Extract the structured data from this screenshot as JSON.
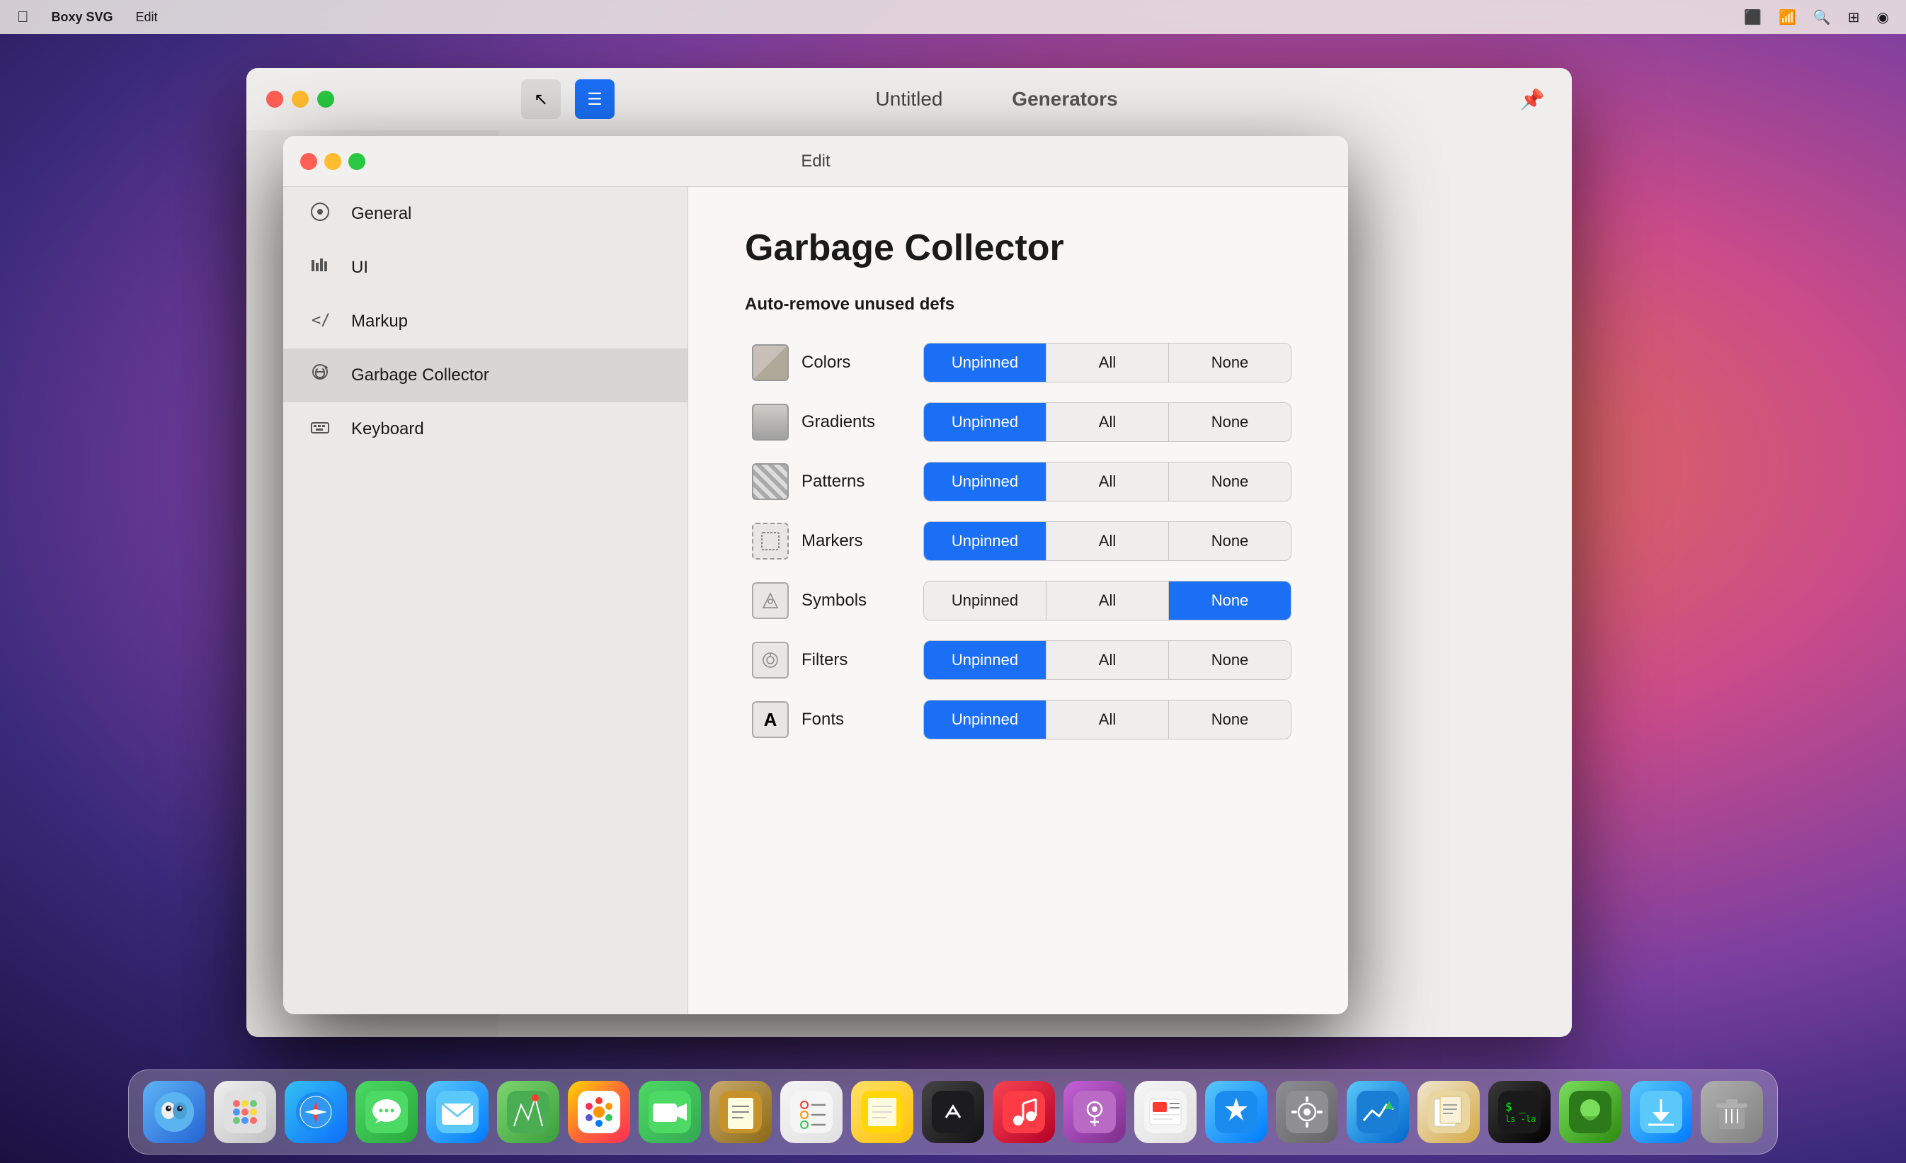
{
  "desktop": {
    "bg_colors": [
      "#e8724a",
      "#c94b8a",
      "#7b3fa0",
      "#3a2a7a",
      "#1a1040"
    ]
  },
  "menubar": {
    "apple": "🍎",
    "app_name": "Boxy SVG",
    "menu_items": [
      "Edit"
    ],
    "right_icons": [
      "monitor-icon",
      "wifi-icon",
      "search-icon",
      "controlcenter-icon",
      "siri-icon"
    ]
  },
  "window_back": {
    "title": "Untitled",
    "controls": {
      "close": "#ff5f57",
      "minimize": "#febc2e",
      "maximize": "#28c840"
    },
    "generators": {
      "title": "Generators",
      "pin_icon": "📌"
    }
  },
  "window_front": {
    "title": "Edit",
    "controls": {
      "close": "#ff5f57",
      "minimize": "#febc2e",
      "maximize": "#28c840"
    },
    "sidebar": {
      "items": [
        {
          "id": "general",
          "icon": "⚙️",
          "label": "General"
        },
        {
          "id": "ui",
          "icon": "📊",
          "label": "UI"
        },
        {
          "id": "markup",
          "icon": "⟨⟩",
          "label": "Markup"
        },
        {
          "id": "garbage-collector",
          "icon": "♻️",
          "label": "Garbage Collector",
          "active": true
        },
        {
          "id": "keyboard",
          "icon": "⌨️",
          "label": "Keyboard"
        }
      ]
    },
    "content": {
      "title": "Garbage Collector",
      "subtitle": "Auto-remove unused defs",
      "rows": [
        {
          "id": "colors",
          "icon_type": "color",
          "label": "Colors",
          "buttons": [
            {
              "label": "Unpinned",
              "active": true,
              "position": "left"
            },
            {
              "label": "All",
              "active": false,
              "position": "middle"
            },
            {
              "label": "None",
              "active": false,
              "position": "right"
            }
          ]
        },
        {
          "id": "gradients",
          "icon_type": "gradient",
          "label": "Gradients",
          "buttons": [
            {
              "label": "Unpinned",
              "active": true,
              "position": "left"
            },
            {
              "label": "All",
              "active": false,
              "position": "middle"
            },
            {
              "label": "None",
              "active": false,
              "position": "right"
            }
          ]
        },
        {
          "id": "patterns",
          "icon_type": "pattern",
          "label": "Patterns",
          "buttons": [
            {
              "label": "Unpinned",
              "active": true,
              "position": "left"
            },
            {
              "label": "All",
              "active": false,
              "position": "middle"
            },
            {
              "label": "None",
              "active": false,
              "position": "right"
            }
          ]
        },
        {
          "id": "markers",
          "icon_type": "marker",
          "label": "Markers",
          "buttons": [
            {
              "label": "Unpinned",
              "active": true,
              "position": "left"
            },
            {
              "label": "All",
              "active": false,
              "position": "middle"
            },
            {
              "label": "None",
              "active": false,
              "position": "right"
            }
          ]
        },
        {
          "id": "symbols",
          "icon_type": "symbol",
          "label": "Symbols",
          "buttons": [
            {
              "label": "Unpinned",
              "active": false,
              "position": "left"
            },
            {
              "label": "All",
              "active": false,
              "position": "middle"
            },
            {
              "label": "None",
              "active": true,
              "position": "right"
            }
          ]
        },
        {
          "id": "filters",
          "icon_type": "filter",
          "label": "Filters",
          "buttons": [
            {
              "label": "Unpinned",
              "active": true,
              "position": "left"
            },
            {
              "label": "All",
              "active": false,
              "position": "middle"
            },
            {
              "label": "None",
              "active": false,
              "position": "right"
            }
          ]
        },
        {
          "id": "fonts",
          "icon_type": "font",
          "label": "Fonts",
          "buttons": [
            {
              "label": "Unpinned",
              "active": true,
              "position": "left"
            },
            {
              "label": "All",
              "active": false,
              "position": "middle"
            },
            {
              "label": "None",
              "active": false,
              "position": "right"
            }
          ]
        }
      ]
    }
  },
  "dock": {
    "items": [
      {
        "id": "finder",
        "icon": "🔵",
        "label": "Finder",
        "color_class": "dock-finder"
      },
      {
        "id": "launchpad",
        "icon": "🟣",
        "label": "Launchpad",
        "color_class": "dock-launchpad"
      },
      {
        "id": "safari",
        "icon": "🧭",
        "label": "Safari",
        "color_class": "dock-safari"
      },
      {
        "id": "messages",
        "icon": "💬",
        "label": "Messages",
        "color_class": "dock-messages"
      },
      {
        "id": "mail",
        "icon": "✉️",
        "label": "Mail",
        "color_class": "dock-mail"
      },
      {
        "id": "maps",
        "icon": "🗺️",
        "label": "Maps",
        "color_class": "dock-maps"
      },
      {
        "id": "photos",
        "icon": "🌸",
        "label": "Photos",
        "color_class": "dock-photos"
      },
      {
        "id": "facetime",
        "icon": "📹",
        "label": "FaceTime",
        "color_class": "dock-facetime"
      },
      {
        "id": "notes-brown",
        "icon": "📝",
        "label": "Notes",
        "color_class": "dock-notes-brown"
      },
      {
        "id": "reminders",
        "icon": "✅",
        "label": "Reminders",
        "color_class": "dock-reminders"
      },
      {
        "id": "notes-yellow",
        "icon": "📄",
        "label": "Stickies",
        "color_class": "dock-notes-yellow"
      },
      {
        "id": "appletv",
        "icon": "📺",
        "label": "Apple TV",
        "color_class": "dock-appletv"
      },
      {
        "id": "music",
        "icon": "🎵",
        "label": "Music",
        "color_class": "dock-music"
      },
      {
        "id": "podcasts",
        "icon": "🎙️",
        "label": "Podcasts",
        "color_class": "dock-podcasts"
      },
      {
        "id": "news",
        "icon": "📰",
        "label": "News",
        "color_class": "dock-news"
      },
      {
        "id": "appstore",
        "icon": "🅰️",
        "label": "App Store",
        "color_class": "dock-appstore"
      },
      {
        "id": "syspref",
        "icon": "⚙️",
        "label": "System Preferences",
        "color_class": "dock-syspref"
      },
      {
        "id": "altimeter",
        "icon": "📈",
        "label": "AltaMetrica",
        "color_class": "dock-altimeter"
      },
      {
        "id": "preview",
        "icon": "🖼️",
        "label": "Preview",
        "color_class": "dock-preview"
      },
      {
        "id": "terminal",
        "icon": "💻",
        "label": "Terminal",
        "color_class": "dock-terminal"
      },
      {
        "id": "pixelmator",
        "icon": "🌿",
        "label": "Pixelmator",
        "color_class": "dock-pixelmator"
      },
      {
        "id": "downloads",
        "icon": "⬇️",
        "label": "Downloads",
        "color_class": "dock-downloads"
      },
      {
        "id": "trash",
        "icon": "🗑️",
        "label": "Trash",
        "color_class": "dock-trash"
      }
    ]
  }
}
